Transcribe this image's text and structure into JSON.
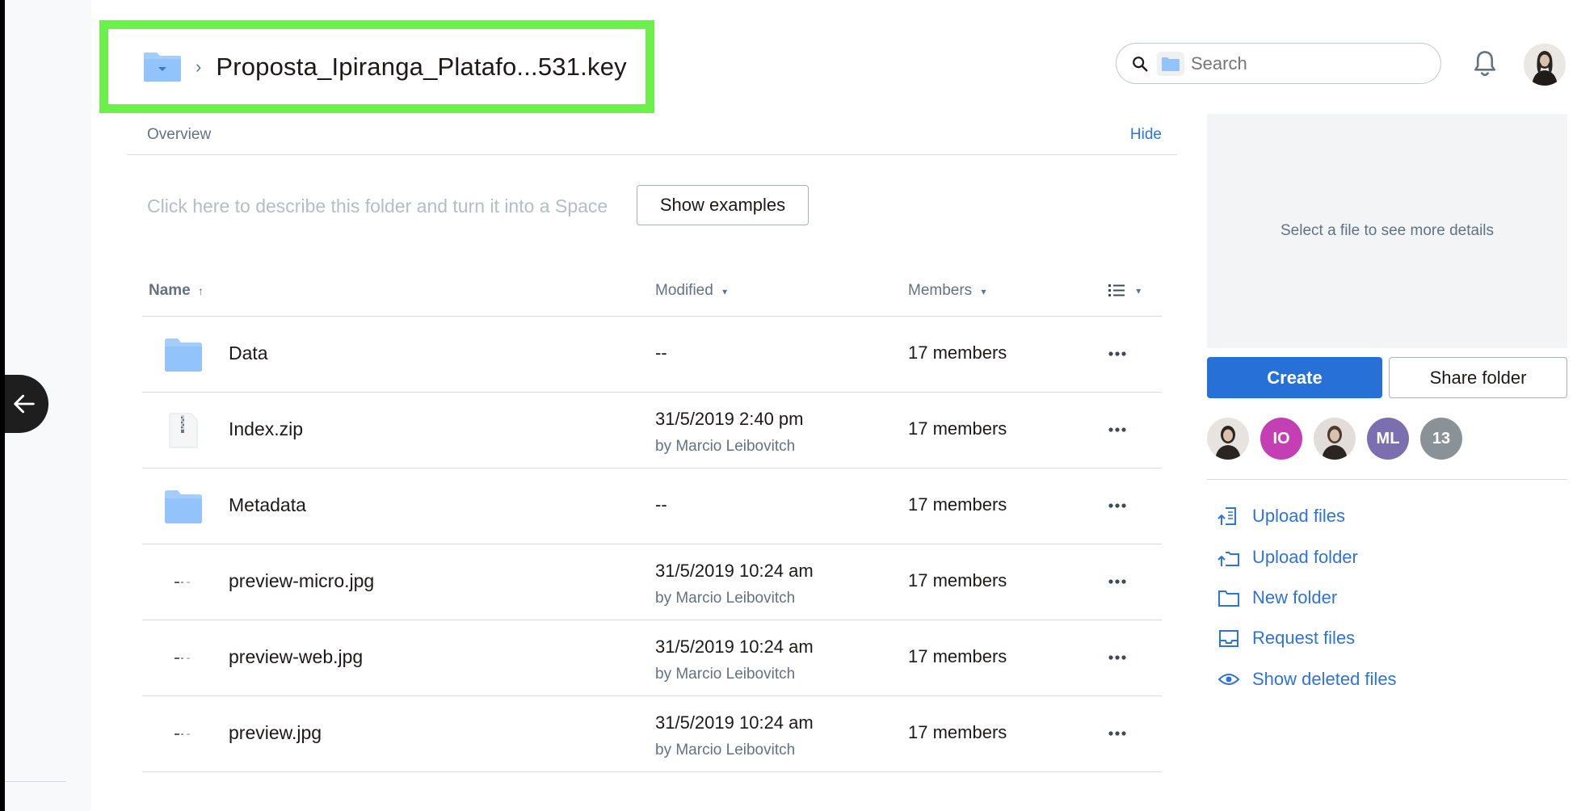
{
  "breadcrumb": {
    "title": "Proposta_Ipiranga_Platafo...531.key"
  },
  "search": {
    "placeholder": "Search"
  },
  "overview": {
    "label": "Overview",
    "hide_label": "Hide",
    "describe_placeholder": "Click here to describe this folder and turn it into a Space",
    "show_examples_label": "Show examples"
  },
  "table": {
    "headers": {
      "name": "Name",
      "modified": "Modified",
      "members": "Members"
    },
    "rows": [
      {
        "name": "Data",
        "icon": "folder-icon",
        "modified": "--",
        "modified_by": "",
        "members": "17 members"
      },
      {
        "name": "Index.zip",
        "icon": "zip-file-icon",
        "modified": "31/5/2019 2:40 pm",
        "modified_by": "by Marcio Leibovitch",
        "members": "17 members"
      },
      {
        "name": "Metadata",
        "icon": "folder-icon",
        "modified": "--",
        "modified_by": "",
        "members": "17 members"
      },
      {
        "name": "preview-micro.jpg",
        "icon": "image-thumbnail-icon",
        "modified": "31/5/2019 10:24 am",
        "modified_by": "by Marcio Leibovitch",
        "members": "17 members"
      },
      {
        "name": "preview-web.jpg",
        "icon": "image-thumbnail-icon",
        "modified": "31/5/2019 10:24 am",
        "modified_by": "by Marcio Leibovitch",
        "members": "17 members"
      },
      {
        "name": "preview.jpg",
        "icon": "image-thumbnail-icon",
        "modified": "31/5/2019 10:24 am",
        "modified_by": "by Marcio Leibovitch",
        "members": "17 members"
      }
    ]
  },
  "panel": {
    "details_placeholder": "Select a file to see more details",
    "create_label": "Create",
    "share_label": "Share folder",
    "members": [
      {
        "initials": "",
        "color": "#e7e4e0",
        "kind": "photo"
      },
      {
        "initials": "IO",
        "color": "#c53fb4",
        "kind": "initials"
      },
      {
        "initials": "",
        "color": "#e2ddd8",
        "kind": "photo"
      },
      {
        "initials": "ML",
        "color": "#7b6faf",
        "kind": "initials"
      },
      {
        "initials": "13",
        "color": "#8a9197",
        "kind": "count"
      }
    ],
    "actions": [
      {
        "label": "Upload files",
        "icon": "upload-files-icon"
      },
      {
        "label": "Upload folder",
        "icon": "upload-folder-icon"
      },
      {
        "label": "New folder",
        "icon": "new-folder-icon"
      },
      {
        "label": "Request files",
        "icon": "request-files-icon"
      },
      {
        "label": "Show deleted files",
        "icon": "eye-icon"
      }
    ]
  },
  "colors": {
    "accent": "#2770d8",
    "link": "#2d73d8",
    "highlight": "#6cf04b",
    "folder": "#a3cdfb"
  }
}
